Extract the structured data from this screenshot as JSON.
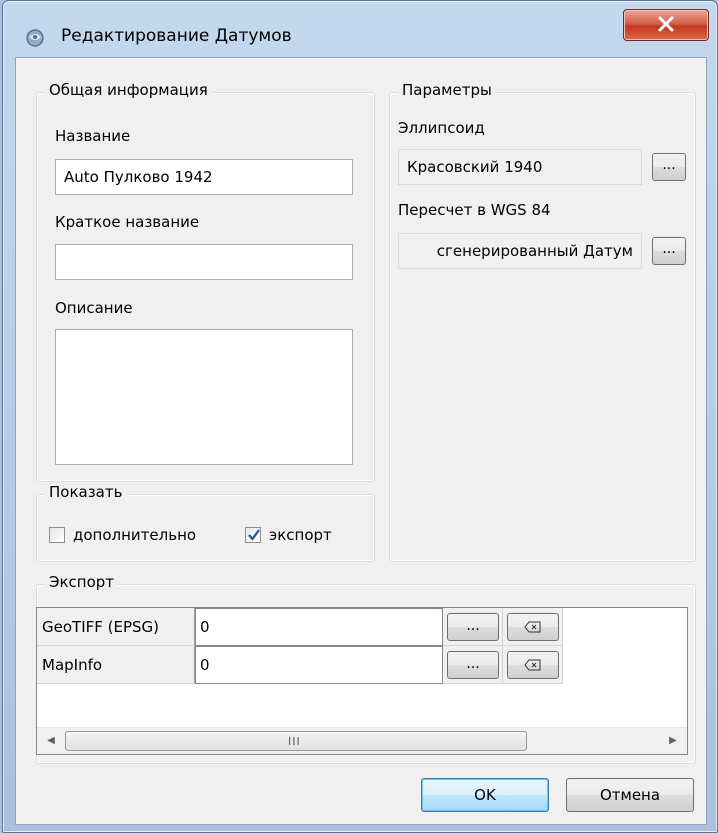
{
  "window": {
    "title": "Редактирование Датумов",
    "icon": "datum-app-icon",
    "close_icon": "close-icon"
  },
  "general": {
    "legend": "Общая информация",
    "name_label": "Название",
    "name_value": "Auto Пулково 1942",
    "short_label": "Краткое название",
    "short_value": "",
    "desc_label": "Описание",
    "desc_value": ""
  },
  "params": {
    "legend": "Параметры",
    "ellipsoid_label": "Эллипсоид",
    "ellipsoid_value": "Красовский 1940",
    "ellipsoid_btn": "...",
    "wgs_label": "Пересчет в WGS 84",
    "wgs_value": "сгенерированный Датум",
    "wgs_btn": "..."
  },
  "show": {
    "legend": "Показать",
    "extra_label": "дополнительно",
    "extra_checked": false,
    "export_label": "экспорт",
    "export_checked": true
  },
  "export": {
    "legend": "Экспорт",
    "rows": [
      {
        "name": "GeoTIFF (EPSG)",
        "value": "0",
        "btn": "..."
      },
      {
        "name": "MapInfo",
        "value": "0",
        "btn": "..."
      }
    ],
    "scroll_left": "◀",
    "scroll_right": "▶",
    "scroll_grip": "III"
  },
  "buttons": {
    "ok": "OK",
    "cancel": "Отмена"
  }
}
